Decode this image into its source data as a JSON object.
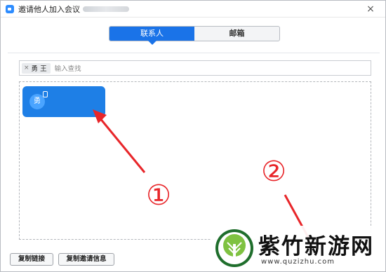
{
  "window": {
    "title": "邀请他人加入会议",
    "close_glyph": "×"
  },
  "tabs": [
    {
      "label": "联系人",
      "active": true
    },
    {
      "label": "邮箱",
      "active": false
    }
  ],
  "search": {
    "chip_label": "勇 王",
    "chip_remove_glyph": "×",
    "placeholder": "输入查找"
  },
  "contacts": [
    {
      "avatar_text": "勇",
      "selected": true
    }
  ],
  "buttons": {
    "copy_link": "复制链接",
    "copy_invite": "复制邀请信息"
  },
  "annotations": {
    "marker_1": "①",
    "marker_2": "②"
  },
  "watermark": {
    "site_name": "紫竹新游网",
    "url": "www.quzizhu.com"
  },
  "colors": {
    "accent": "#1a73e8",
    "arrow": "#e8262a"
  }
}
